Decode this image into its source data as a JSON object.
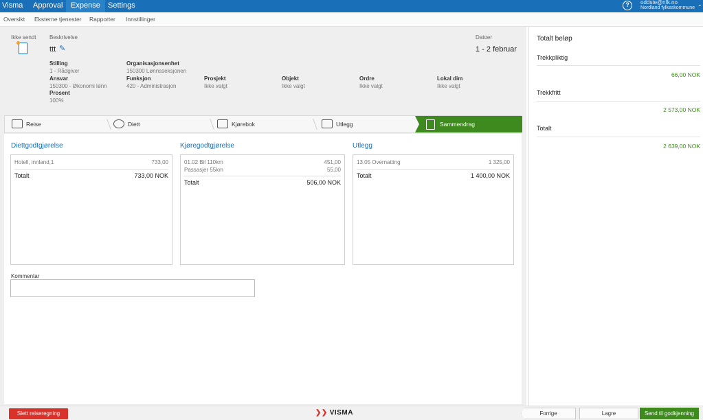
{
  "topnav": {
    "brand": "Visma",
    "tabs": [
      "Approval",
      "Expense",
      "Settings"
    ],
    "active_tab": "Expense",
    "user_email": "oddste@nfk.no",
    "user_org": "Nordland fylkeskommune",
    "help_icon": "question-circle-icon"
  },
  "subnav": {
    "items": [
      "Oversikt",
      "Eksterne tjenester",
      "Rapporter",
      "Innstillinger"
    ]
  },
  "header": {
    "status_label": "Ikke sendt",
    "description_label": "Beskrivelse",
    "description_value": "ttt",
    "dates_label": "Datoer",
    "dates_value": "1 - 2 februar",
    "fields": {
      "stilling_label": "Stilling",
      "stilling_value": "1 - Rådgiver",
      "ansvar_label": "Ansvar",
      "ansvar_value": "150300 - Økonomi lønn",
      "prosent_label": "Prosent",
      "prosent_value": "100%",
      "org_label": "Organisasjonsenhet",
      "org_value": "150300 Lønnsseksjonen",
      "funksjon_label": "Funksjon",
      "funksjon_value": "420 - Administrasjon",
      "prosjekt_label": "Prosjekt",
      "prosjekt_value": "Ikke valgt",
      "objekt_label": "Objekt",
      "objekt_value": "Ikke valgt",
      "ordre_label": "Ordre",
      "ordre_value": "Ikke valgt",
      "lokaldim_label": "Lokal dim",
      "lokaldim_value": "Ikke valgt"
    }
  },
  "steps": [
    "Reise",
    "Diett",
    "Kjørebok",
    "Utlegg",
    "Sammendrag"
  ],
  "active_step": "Sammendrag",
  "cards": {
    "diett": {
      "title": "Diettgodtgjørelse",
      "lines": [
        {
          "label": "Hotell, innland,1",
          "amount": "733,00"
        }
      ],
      "total_label": "Totalt",
      "total_value": "733,00 NOK"
    },
    "kjore": {
      "title": "Kjøregodtgjørelse",
      "lines": [
        {
          "label": "01.02 Bil 110km",
          "amount": "451,00"
        },
        {
          "label": "Passasjer 55km",
          "amount": "55,00"
        }
      ],
      "total_label": "Totalt",
      "total_value": "506,00 NOK"
    },
    "utlegg": {
      "title": "Utlegg",
      "lines": [
        {
          "label": "13.05 Overnatting",
          "amount": "1 325,00"
        }
      ],
      "total_label": "Totalt",
      "total_value": "1 400,00 NOK"
    }
  },
  "comment": {
    "label": "Kommentar",
    "value": ""
  },
  "totals": {
    "title": "Totalt beløp",
    "trekkpliktig_label": "Trekkpliktig",
    "trekkpliktig_value": "66,00 NOK",
    "trekkfritt_label": "Trekkfritt",
    "trekkfritt_value": "2 573,00 NOK",
    "totalt_label": "Totalt",
    "totalt_value": "2 639,00 NOK"
  },
  "footer": {
    "delete_label": "Slett reiseregning",
    "logo_text": "VISMA",
    "prev_label": "Forrige",
    "save_label": "Lagre",
    "send_label": "Send til godkjenning"
  },
  "colors": {
    "brand_blue": "#1a70b8",
    "green": "#3f8a1f",
    "red": "#d9322b"
  }
}
